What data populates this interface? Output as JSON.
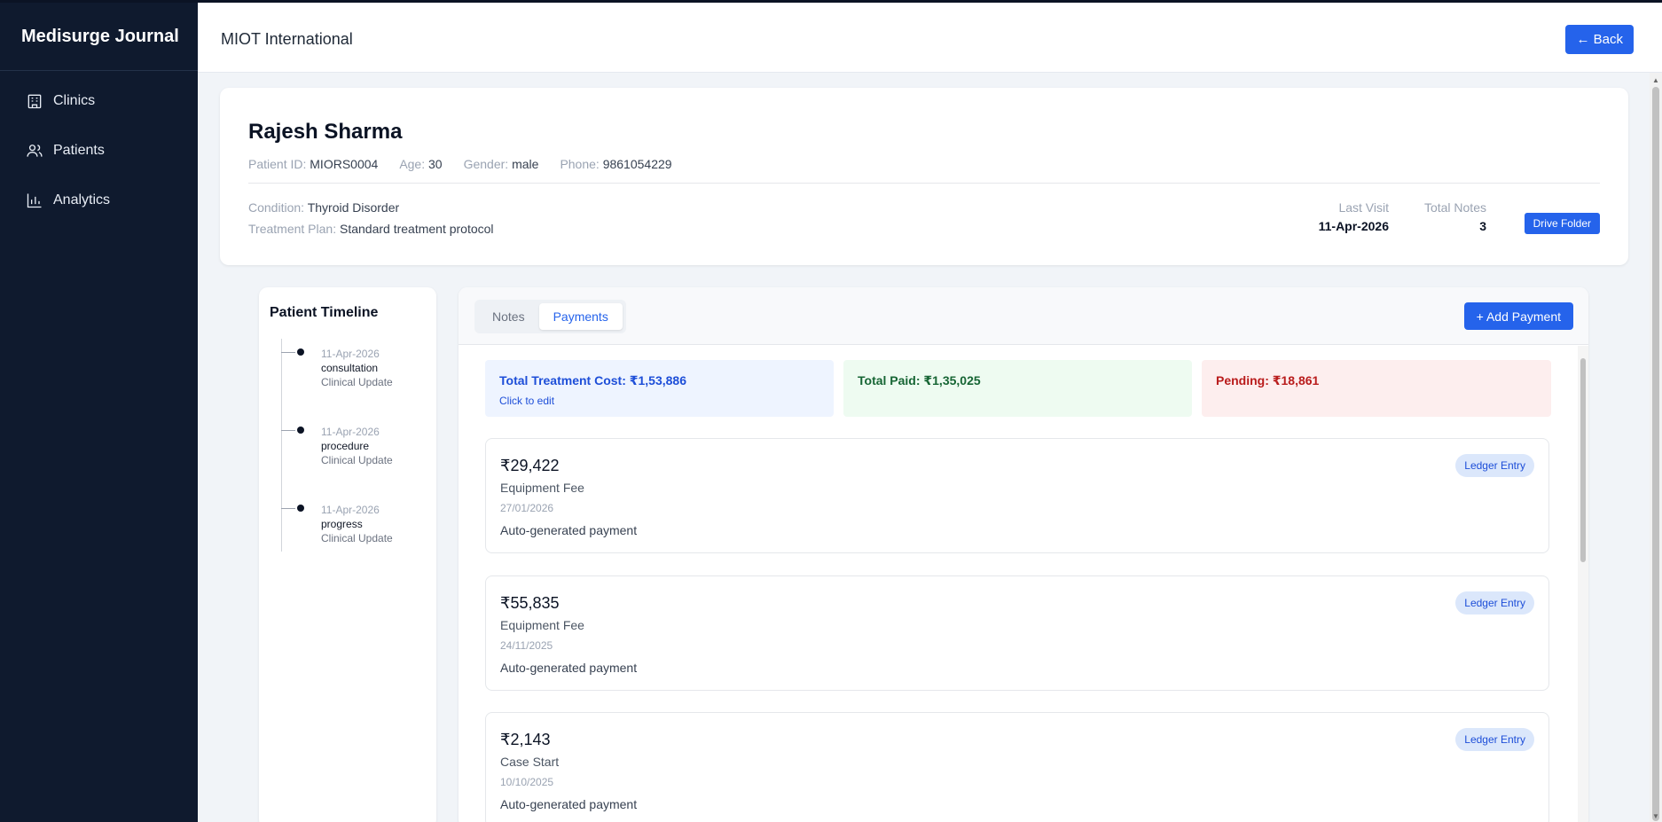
{
  "app": {
    "brand": "Medisurge Journal"
  },
  "sidebar": {
    "items": [
      {
        "label": "Clinics",
        "icon": "building-icon"
      },
      {
        "label": "Patients",
        "icon": "users-icon"
      },
      {
        "label": "Analytics",
        "icon": "bar-chart-icon"
      }
    ]
  },
  "header": {
    "title": "MIOT International",
    "back_label": "← Back"
  },
  "patient": {
    "name": "Rajesh Sharma",
    "id_label": "Patient ID:",
    "id": "MIORS0004",
    "age_label": "Age:",
    "age": "30",
    "gender_label": "Gender:",
    "gender": "male",
    "phone_label": "Phone:",
    "phone": "9861054229",
    "condition_label": "Condition:",
    "condition": "Thyroid Disorder",
    "plan_label": "Treatment Plan:",
    "plan": "Standard treatment protocol",
    "last_visit_label": "Last Visit",
    "last_visit": "11-Apr-2026",
    "total_notes_label": "Total Notes",
    "total_notes": "3",
    "drive_label": "Drive Folder"
  },
  "timeline": {
    "title": "Patient Timeline",
    "entries": [
      {
        "date": "11-Apr-2026",
        "type": "consultation",
        "sub": "Clinical Update"
      },
      {
        "date": "11-Apr-2026",
        "type": "procedure",
        "sub": "Clinical Update"
      },
      {
        "date": "11-Apr-2026",
        "type": "progress",
        "sub": "Clinical Update"
      }
    ]
  },
  "tabs": {
    "notes": "Notes",
    "payments": "Payments",
    "active": "Payments"
  },
  "add_payment_label": "+ Add Payment",
  "summary": {
    "cost": "Total Treatment Cost: ₹1,53,886",
    "cost_hint": "Click to edit",
    "paid": "Total Paid: ₹1,35,025",
    "pending": "Pending: ₹18,861"
  },
  "payments": [
    {
      "amount": "₹29,422",
      "category": "Equipment Fee",
      "date": "27/01/2026",
      "note": "Auto-generated payment",
      "badge": "Ledger Entry"
    },
    {
      "amount": "₹55,835",
      "category": "Equipment Fee",
      "date": "24/11/2025",
      "note": "Auto-generated payment",
      "badge": "Ledger Entry"
    },
    {
      "amount": "₹2,143",
      "category": "Case Start",
      "date": "10/10/2025",
      "note": "Auto-generated payment",
      "badge": "Ledger Entry"
    }
  ],
  "colors": {
    "sidebar_bg": "#0f1a2e",
    "accent": "#2563eb",
    "paid": "#166534",
    "pending": "#b91c1c"
  }
}
